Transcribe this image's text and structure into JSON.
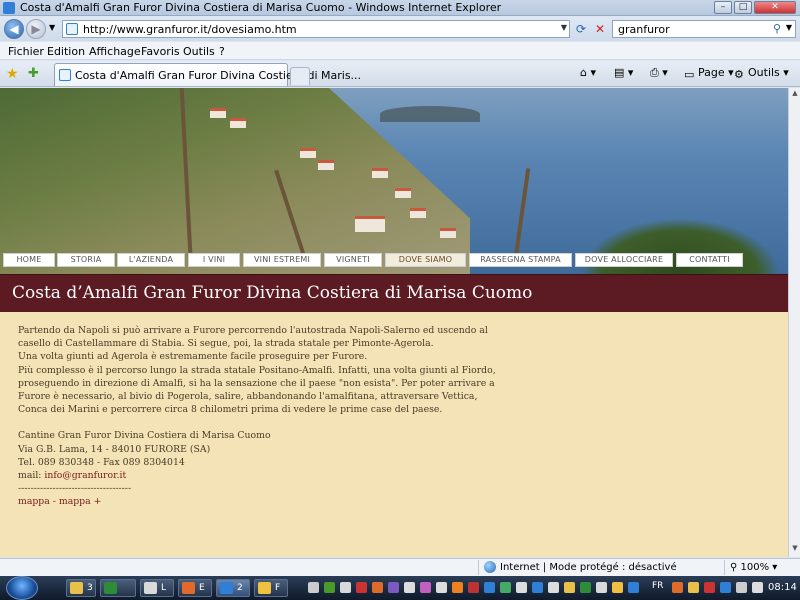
{
  "window": {
    "title": "Costa d'Amalfi Gran Furor Divina Costiera di Marisa Cuomo - Windows Internet Explorer",
    "minimize": "–",
    "maximize": "□",
    "close": "✕"
  },
  "address": {
    "url": "http://www.granfuror.it/dovesiamo.htm"
  },
  "search": {
    "query": "granfuror"
  },
  "menu": [
    "Fichier",
    "Edition",
    "Affichage",
    "Favoris",
    "Outils",
    "?"
  ],
  "tab": {
    "label": "Costa d'Amalfi Gran Furor Divina Costiera di Maris..."
  },
  "commands": {
    "page": "Page",
    "tools": "Outils"
  },
  "site": {
    "nav": [
      "HOME",
      "STORIA",
      "L'AZIENDA",
      "I VINI",
      "VINI ESTREMI",
      "VIGNETI",
      "DOVE SIAMO",
      "RASSEGNA STAMPA",
      "DOVE ALLOCCIARE",
      "CONTATTI"
    ],
    "active_nav": "DOVE SIAMO",
    "heading": "Costa d’Amalfi Gran Furor Divina Costiera di Marisa Cuomo",
    "paragraph_lines": [
      "Partendo da Napoli si può arrivare a Furore percorrendo l'autostrada Napoli-Salerno ed uscendo al",
      "casello di Castellammare di Stabia. Si segue, poi, la strada statale per Pimonte-Agerola.",
      "Una volta giunti ad Agerola è estremamente facile proseguire per Furore.",
      "Più complesso è il percorso lungo la strada statale Positano-Amalfi. Infatti, una volta giunti al Fiordo,",
      "proseguendo in direzione di Amalfi, si ha la sensazione che il paese \"non esista\". Per poter arrivare a",
      "Furore è necessario, al bivio di Pogerola, salire, abbandonando l'amalfitana, attraversare Vettica,",
      "Conca dei Marini e percorrere circa 8 chilometri prima di vedere le prime case del paese."
    ],
    "contact": {
      "name": "Cantine Gran Furor Divina Costiera di Marisa Cuomo",
      "address": "Via G.B. Lama, 14 - 84010 FURORE (SA)",
      "phone": "Tel. 089 830348 - Fax 089 8304014",
      "email_label": "mail: ",
      "email": "info@granfuror.it",
      "divider": "------------------------------------",
      "map_link_1": "mappa",
      "map_sep": " - ",
      "map_link_2": "mappa +"
    }
  },
  "status": {
    "zone": "Internet | Mode protégé : désactivé",
    "zoom": "100%"
  },
  "taskbar": {
    "items": [
      {
        "label": "3",
        "icon_color": "#e8c14a"
      },
      {
        "label": "",
        "icon_color": "#2e8b3a"
      },
      {
        "label": "L",
        "icon_color": "#d9d9d9"
      },
      {
        "label": "E",
        "icon_color": "#e06a2a"
      },
      {
        "label": "2",
        "icon_color": "#2f7fd6"
      },
      {
        "label": "F",
        "icon_color": "#f0c040"
      }
    ],
    "language": "FR",
    "time": "08:14"
  },
  "colors": {
    "header_bar": "#5c1a22",
    "content_bg": "#f3e3b6",
    "body_text": "#4a3a26",
    "link": "#7a1a1a"
  }
}
